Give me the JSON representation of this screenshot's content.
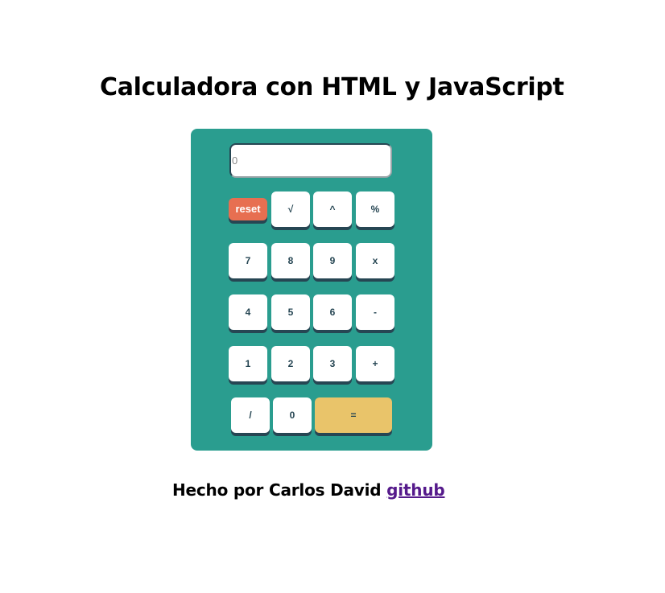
{
  "page": {
    "title": "Calculadora con HTML y JavaScript"
  },
  "calculator": {
    "display_placeholder": "0",
    "display_value": "",
    "buttons": {
      "reset": "reset",
      "sqrt": "√",
      "power": "^",
      "percent": "%",
      "seven": "7",
      "eight": "8",
      "nine": "9",
      "multiply": "x",
      "four": "4",
      "five": "5",
      "six": "6",
      "minus": "-",
      "one": "1",
      "two": "2",
      "three": "3",
      "plus": "+",
      "divide": "/",
      "zero": "0",
      "equals": "="
    },
    "colors": {
      "body": "#2a9d8f",
      "button": "#ffffff",
      "button_text": "#264653",
      "reset": "#e76f51",
      "equals": "#e9c46a"
    }
  },
  "footer": {
    "text": "Hecho por Carlos David ",
    "link_label": "github"
  }
}
